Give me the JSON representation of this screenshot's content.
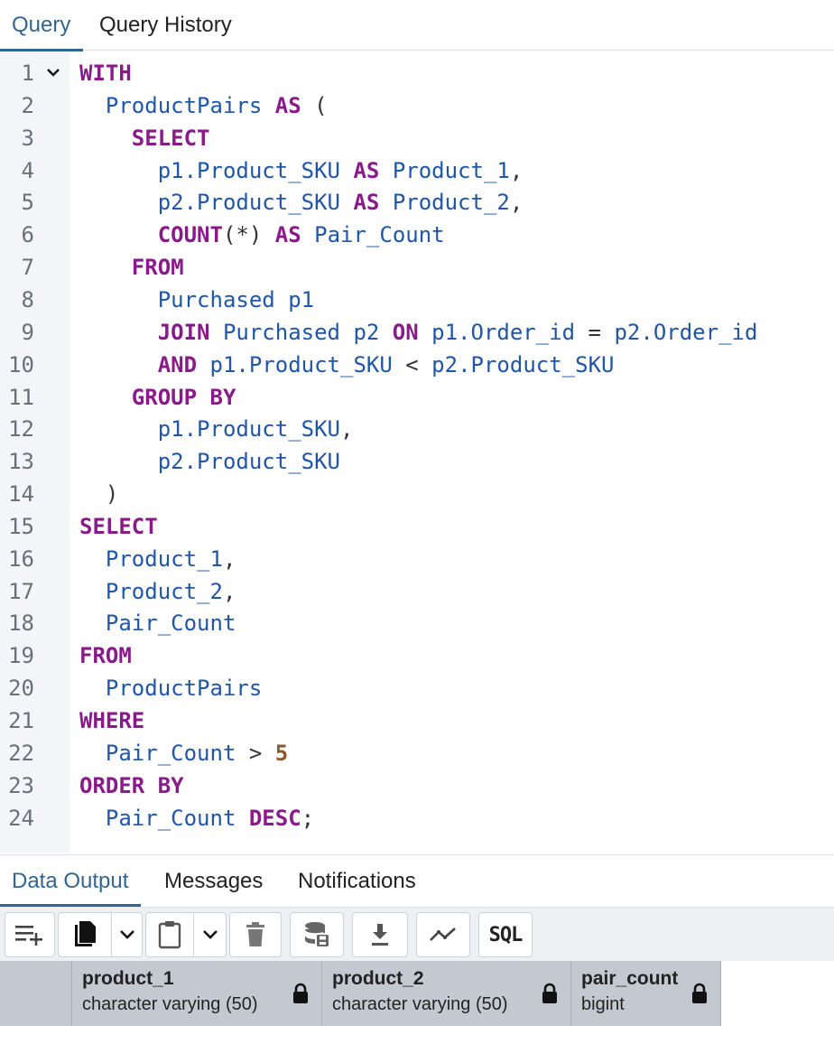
{
  "query_tabs": [
    {
      "label": "Query",
      "active": true
    },
    {
      "label": "Query History",
      "active": false
    }
  ],
  "editor": {
    "lines": [
      [
        {
          "t": "WITH",
          "c": "kw"
        }
      ],
      [
        {
          "t": "  "
        },
        {
          "t": "ProductPairs",
          "c": "id"
        },
        {
          "t": " "
        },
        {
          "t": "AS",
          "c": "kw"
        },
        {
          "t": " (",
          "c": "op"
        }
      ],
      [
        {
          "t": "    "
        },
        {
          "t": "SELECT",
          "c": "kw"
        }
      ],
      [
        {
          "t": "      "
        },
        {
          "t": "p1.Product_SKU",
          "c": "id"
        },
        {
          "t": " "
        },
        {
          "t": "AS",
          "c": "kw"
        },
        {
          "t": " "
        },
        {
          "t": "Product_1",
          "c": "id"
        },
        {
          "t": ",",
          "c": "op"
        }
      ],
      [
        {
          "t": "      "
        },
        {
          "t": "p2.Product_SKU",
          "c": "id"
        },
        {
          "t": " "
        },
        {
          "t": "AS",
          "c": "kw"
        },
        {
          "t": " "
        },
        {
          "t": "Product_2",
          "c": "id"
        },
        {
          "t": ",",
          "c": "op"
        }
      ],
      [
        {
          "t": "      "
        },
        {
          "t": "COUNT",
          "c": "kw"
        },
        {
          "t": "(*)",
          "c": "op"
        },
        {
          "t": " "
        },
        {
          "t": "AS",
          "c": "kw"
        },
        {
          "t": " "
        },
        {
          "t": "Pair_Count",
          "c": "id"
        }
      ],
      [
        {
          "t": "    "
        },
        {
          "t": "FROM",
          "c": "kw"
        }
      ],
      [
        {
          "t": "      "
        },
        {
          "t": "Purchased p1",
          "c": "id"
        }
      ],
      [
        {
          "t": "      "
        },
        {
          "t": "JOIN",
          "c": "kw"
        },
        {
          "t": " "
        },
        {
          "t": "Purchased p2",
          "c": "id"
        },
        {
          "t": " "
        },
        {
          "t": "ON",
          "c": "kw"
        },
        {
          "t": " "
        },
        {
          "t": "p1.Order_id",
          "c": "id"
        },
        {
          "t": " = ",
          "c": "op"
        },
        {
          "t": "p2.Order_id",
          "c": "id"
        }
      ],
      [
        {
          "t": "      "
        },
        {
          "t": "AND",
          "c": "kw"
        },
        {
          "t": " "
        },
        {
          "t": "p1.Product_SKU",
          "c": "id"
        },
        {
          "t": " < ",
          "c": "op"
        },
        {
          "t": "p2.Product_SKU",
          "c": "id"
        }
      ],
      [
        {
          "t": "    "
        },
        {
          "t": "GROUP BY",
          "c": "kw"
        }
      ],
      [
        {
          "t": "      "
        },
        {
          "t": "p1.Product_SKU",
          "c": "id"
        },
        {
          "t": ",",
          "c": "op"
        }
      ],
      [
        {
          "t": "      "
        },
        {
          "t": "p2.Product_SKU",
          "c": "id"
        }
      ],
      [
        {
          "t": "  "
        },
        {
          "t": ")",
          "c": "op"
        }
      ],
      [
        {
          "t": "SELECT",
          "c": "kw"
        }
      ],
      [
        {
          "t": "  "
        },
        {
          "t": "Product_1",
          "c": "id"
        },
        {
          "t": ",",
          "c": "op"
        }
      ],
      [
        {
          "t": "  "
        },
        {
          "t": "Product_2",
          "c": "id"
        },
        {
          "t": ",",
          "c": "op"
        }
      ],
      [
        {
          "t": "  "
        },
        {
          "t": "Pair_Count",
          "c": "id"
        }
      ],
      [
        {
          "t": "FROM",
          "c": "kw"
        }
      ],
      [
        {
          "t": "  "
        },
        {
          "t": "ProductPairs",
          "c": "id"
        }
      ],
      [
        {
          "t": "WHERE",
          "c": "kw"
        }
      ],
      [
        {
          "t": "  "
        },
        {
          "t": "Pair_Count",
          "c": "id"
        },
        {
          "t": " > ",
          "c": "op"
        },
        {
          "t": "5",
          "c": "num"
        }
      ],
      [
        {
          "t": "ORDER BY",
          "c": "kw"
        }
      ],
      [
        {
          "t": "  "
        },
        {
          "t": "Pair_Count",
          "c": "id"
        },
        {
          "t": " "
        },
        {
          "t": "DESC",
          "c": "kw"
        },
        {
          "t": ";",
          "c": "op"
        }
      ]
    ],
    "fold_line": 1
  },
  "output_tabs": [
    {
      "label": "Data Output",
      "active": true
    },
    {
      "label": "Messages",
      "active": false
    },
    {
      "label": "Notifications",
      "active": false
    }
  ],
  "toolbar": {
    "sql_label": "SQL",
    "buttons": [
      "add-row-icon",
      "copy-icon",
      "chevron-down-icon",
      "paste-icon",
      "chevron-down-icon",
      "delete-icon",
      "save-data-icon",
      "download-icon",
      "graph-icon",
      "sql-icon"
    ]
  },
  "grid": {
    "columns": [
      {
        "name": "product_1",
        "type": "character varying (50)"
      },
      {
        "name": "product_2",
        "type": "character varying (50)"
      },
      {
        "name": "pair_count",
        "type": "bigint"
      }
    ]
  },
  "colors": {
    "accent": "#326690",
    "keyword": "#8a1a8a",
    "identifier": "#1f56a8",
    "number": "#8a5a2a",
    "gutter_bg": "#f3f5f9",
    "header_bg": "#c4c8d0"
  }
}
